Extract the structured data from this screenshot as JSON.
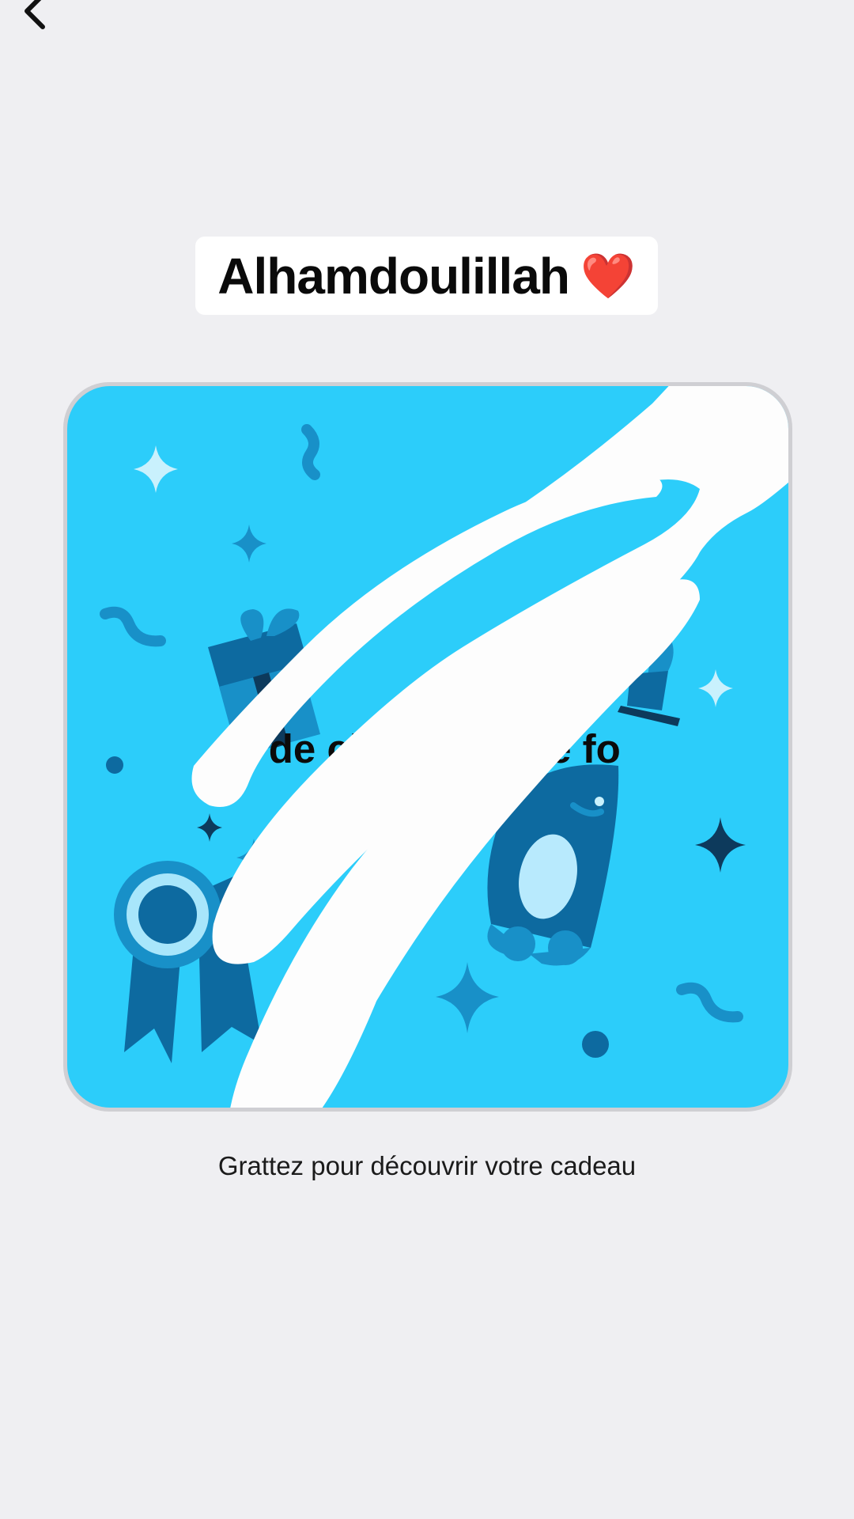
{
  "caption": {
    "text": "Alhamdoulillah",
    "emoji": "❤️",
    "emoji_icon": "red-heart-icon"
  },
  "scratch_card": {
    "partial_result_text": "s de chance cette fo",
    "background_color": "#2ccdfa",
    "scratch_color": "#fdfdfd",
    "illustration_icons": [
      "sparkle-icon",
      "gift-icon",
      "rosette-award-icon",
      "rocket-icon",
      "confetti-squiggle-icon",
      "dot-icon"
    ]
  },
  "instruction": {
    "text": "Grattez pour découvrir votre cadeau"
  },
  "nav": {
    "back_icon": "chevron-left-icon"
  }
}
